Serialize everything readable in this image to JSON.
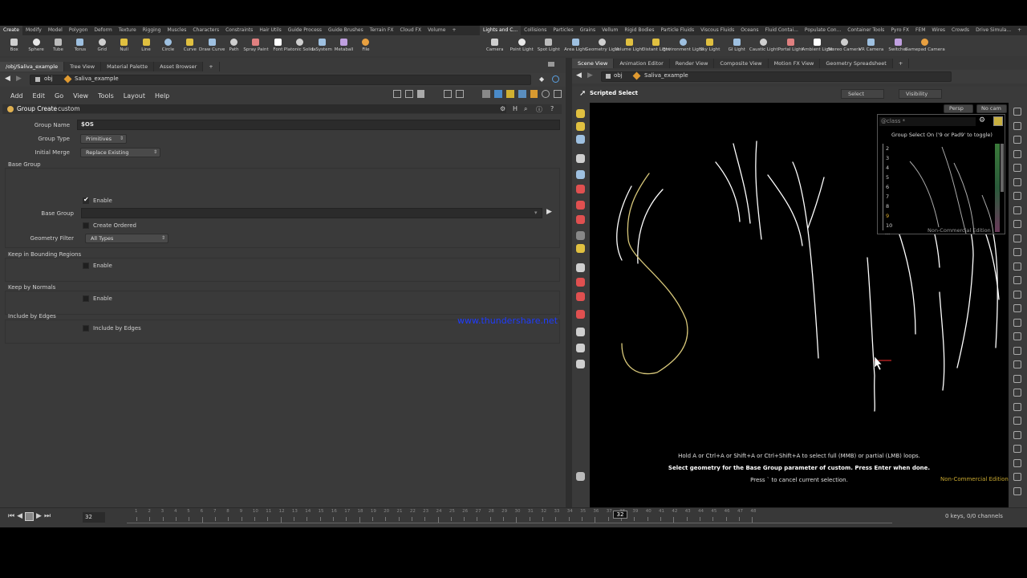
{
  "shelf_left": {
    "tabs": [
      "Create",
      "Modify",
      "Model",
      "Polygon",
      "Deform",
      "Texture",
      "Rigging",
      "Muscles",
      "Characters",
      "Constraints",
      "Hair Utils",
      "Guide Process",
      "Guide Brushes",
      "Terrain FX",
      "Cloud FX",
      "Volume"
    ],
    "tools": [
      "Box",
      "Sphere",
      "Tube",
      "Torus",
      "Grid",
      "Null",
      "Line",
      "Circle",
      "Curve",
      "Draw Curve",
      "Path",
      "Spray Paint",
      "Font",
      "Platonic Solids",
      "L-System",
      "Metaball",
      "File"
    ]
  },
  "shelf_right": {
    "tabs": [
      "Lights and C...",
      "Collisions",
      "Particles",
      "Grains",
      "Vellum",
      "Rigid Bodies",
      "Particle Fluids",
      "Viscous Fluids",
      "Oceans",
      "Fluid Contai...",
      "Populate Con...",
      "Container Tools",
      "Pyro FX",
      "FEM",
      "Wires",
      "Crowds",
      "Drive Simula..."
    ],
    "tools": [
      "Camera",
      "Point Light",
      "Spot Light",
      "Area Light",
      "Geometry Light",
      "Volume Light",
      "Distant Light",
      "Environment Light",
      "Sky Light",
      "GI Light",
      "Caustic Light",
      "Portal Light",
      "Ambient Light",
      "Stereo Camera",
      "VR Camera",
      "Switcher",
      "Gamepad Camera"
    ]
  },
  "left_pane": {
    "tabs": [
      "/obj/Saliva_example",
      "Tree View",
      "Material Palette",
      "Asset Browser"
    ],
    "path_obj": "obj",
    "path_node": "Saliva_example",
    "menu": [
      "Add",
      "Edit",
      "Go",
      "View",
      "Tools",
      "Layout",
      "Help"
    ]
  },
  "params": {
    "node_type": "Group Create",
    "node_name": "custom",
    "group_name_label": "Group Name",
    "group_name_value": "$OS",
    "group_type_label": "Group Type",
    "group_type_value": "Primitives",
    "initial_merge_label": "Initial Merge",
    "initial_merge_value": "Replace Existing",
    "base_group_section": "Base Group",
    "enable_label": "Enable",
    "base_group_label": "Base Group",
    "create_ordered_label": "Create Ordered",
    "geometry_filter_label": "Geometry Filter",
    "geometry_filter_value": "All Types",
    "bounding_section": "Keep in Bounding Regions",
    "normals_section": "Keep by Normals",
    "edges_section": "Include by Edges"
  },
  "watermark": "www.thundershare.net",
  "right_pane": {
    "tabs": [
      "Scene View",
      "Animation Editor",
      "Render View",
      "Composite View",
      "Motion FX View",
      "Geometry Spreadsheet"
    ],
    "path_obj": "obj",
    "path_node": "Saliva_example",
    "tool_name": "Scripted Select",
    "select_mode": "Select",
    "visibility": "Visibility",
    "persp": "Persp",
    "cam": "No cam"
  },
  "group_popup": {
    "filter": "@class *",
    "title": "Group Select On ('9 or Pad9' to toggle)",
    "items": [
      "2",
      "3",
      "4",
      "5",
      "6",
      "7",
      "8",
      "9",
      "10"
    ],
    "more": "...",
    "edition": "Non-Commercial Edition"
  },
  "viewport": {
    "hint1": "Hold A or Ctrl+A or Shift+A or Ctrl+Shift+A to select full (MMB) or partial (LMB) loops.",
    "hint2": "Select geometry for the Base Group parameter of custom. Press Enter when done.",
    "hint3": "Press ` to cancel current selection.",
    "edition": "Non-Commercial Edition"
  },
  "timeline": {
    "frame": "32",
    "current": "32",
    "ticks": [
      "1",
      "2",
      "3",
      "4",
      "5",
      "6",
      "7",
      "8",
      "9",
      "10",
      "11",
      "12",
      "13",
      "14",
      "15",
      "16",
      "17",
      "18",
      "19",
      "20",
      "21",
      "22",
      "23",
      "24",
      "25",
      "26",
      "27",
      "28",
      "29",
      "30",
      "31",
      "32",
      "33",
      "34",
      "35",
      "36",
      "37",
      "38",
      "39",
      "40",
      "41",
      "42",
      "43",
      "44",
      "45",
      "46",
      "47",
      "48"
    ],
    "keys": "0 keys, 0/0 channels"
  },
  "colors": {
    "accent": "#f0c020",
    "selected_curve": "#d8c87a",
    "watermark": "#1f3cff"
  }
}
